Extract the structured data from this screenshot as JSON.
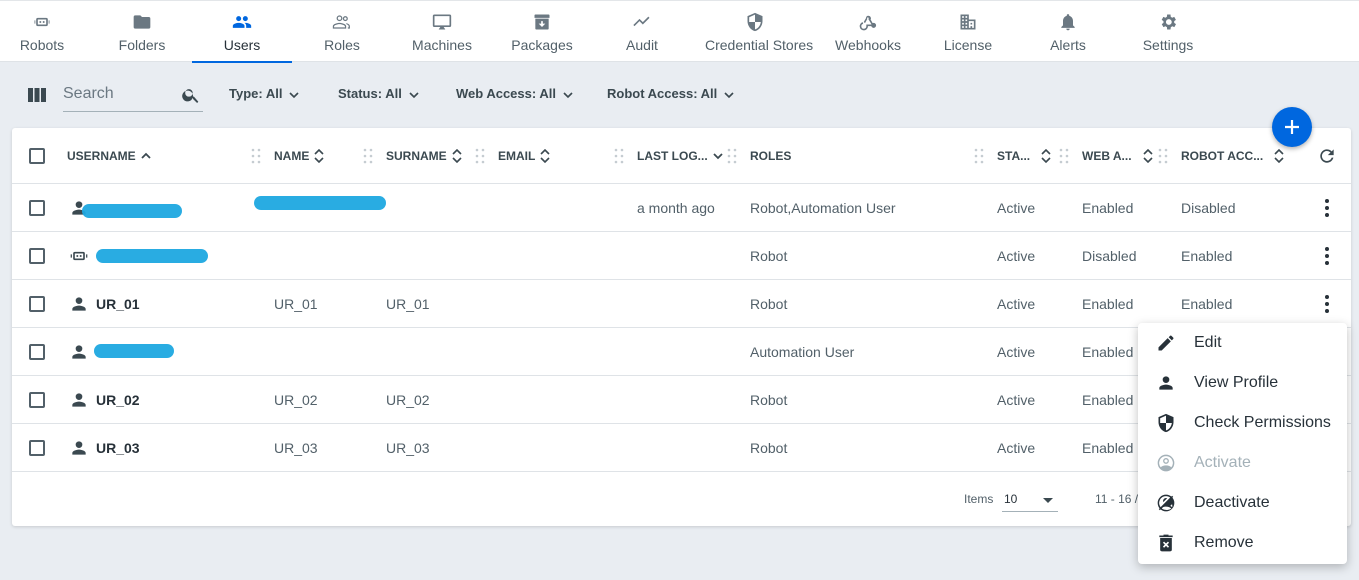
{
  "nav": {
    "tabs": [
      {
        "label": "Robots",
        "icon": "robot-icon"
      },
      {
        "label": "Folders",
        "icon": "folder-icon"
      },
      {
        "label": "Users",
        "icon": "users-icon",
        "active": true
      },
      {
        "label": "Roles",
        "icon": "roles-icon"
      },
      {
        "label": "Machines",
        "icon": "monitor-icon"
      },
      {
        "label": "Packages",
        "icon": "package-icon"
      },
      {
        "label": "Audit",
        "icon": "trend-icon"
      },
      {
        "label": "Credential Stores",
        "icon": "shield-icon"
      },
      {
        "label": "Webhooks",
        "icon": "webhook-icon"
      },
      {
        "label": "License",
        "icon": "building-icon"
      },
      {
        "label": "Alerts",
        "icon": "bell-icon"
      },
      {
        "label": "Settings",
        "icon": "gear-icon"
      }
    ]
  },
  "filters": {
    "search_placeholder": "Search",
    "type": "Type: All",
    "status": "Status: All",
    "web_access": "Web Access: All",
    "robot_access": "Robot Access: All"
  },
  "grid": {
    "columns": {
      "username": "USERNAME",
      "name": "NAME",
      "surname": "SURNAME",
      "email": "EMAIL",
      "last_login": "LAST LOG...",
      "roles": "ROLES",
      "status": "STA...",
      "web_access": "WEB A...",
      "robot_access": "ROBOT ACC..."
    },
    "rows": [
      {
        "username": "",
        "name": "",
        "surname": "",
        "email": "",
        "last_login": "a month ago",
        "roles": "Robot,Automation User",
        "status": "Active",
        "web_access": "Enabled",
        "robot_access": "Disabled",
        "icon": "person-icon"
      },
      {
        "username": "",
        "name": "",
        "surname": "",
        "email": "",
        "last_login": "",
        "roles": "Robot",
        "status": "Active",
        "web_access": "Disabled",
        "robot_access": "Enabled",
        "icon": "robot-icon"
      },
      {
        "username": "UR_01",
        "name": "UR_01",
        "surname": "UR_01",
        "email": "",
        "last_login": "",
        "roles": "Robot",
        "status": "Active",
        "web_access": "Enabled",
        "robot_access": "Enabled",
        "icon": "person-icon"
      },
      {
        "username": "",
        "name": "",
        "surname": "",
        "email": "",
        "last_login": "",
        "roles": "Automation User",
        "status": "Active",
        "web_access": "Enabled",
        "robot_access": "",
        "icon": "person-icon"
      },
      {
        "username": "UR_02",
        "name": "UR_02",
        "surname": "UR_02",
        "email": "",
        "last_login": "",
        "roles": "Robot",
        "status": "Active",
        "web_access": "Enabled",
        "robot_access": "",
        "icon": "person-icon"
      },
      {
        "username": "UR_03",
        "name": "UR_03",
        "surname": "UR_03",
        "email": "",
        "last_login": "",
        "roles": "Robot",
        "status": "Active",
        "web_access": "Enabled",
        "robot_access": "",
        "icon": "person-icon"
      }
    ],
    "footer": {
      "items_label": "Items",
      "items_per_page": "10",
      "range": "11 - 16 /"
    }
  },
  "context_menu": {
    "items": [
      {
        "label": "Edit",
        "icon": "pencil-icon"
      },
      {
        "label": "View Profile",
        "icon": "person-icon"
      },
      {
        "label": "Check Permissions",
        "icon": "shield-icon"
      },
      {
        "label": "Activate",
        "icon": "account-circle-icon",
        "disabled": true
      },
      {
        "label": "Deactivate",
        "icon": "account-off-icon"
      },
      {
        "label": "Remove",
        "icon": "trash-icon"
      }
    ]
  },
  "colors": {
    "accent": "#0067df",
    "redaction": "#1ea8e0",
    "background": "#e9edf2"
  }
}
